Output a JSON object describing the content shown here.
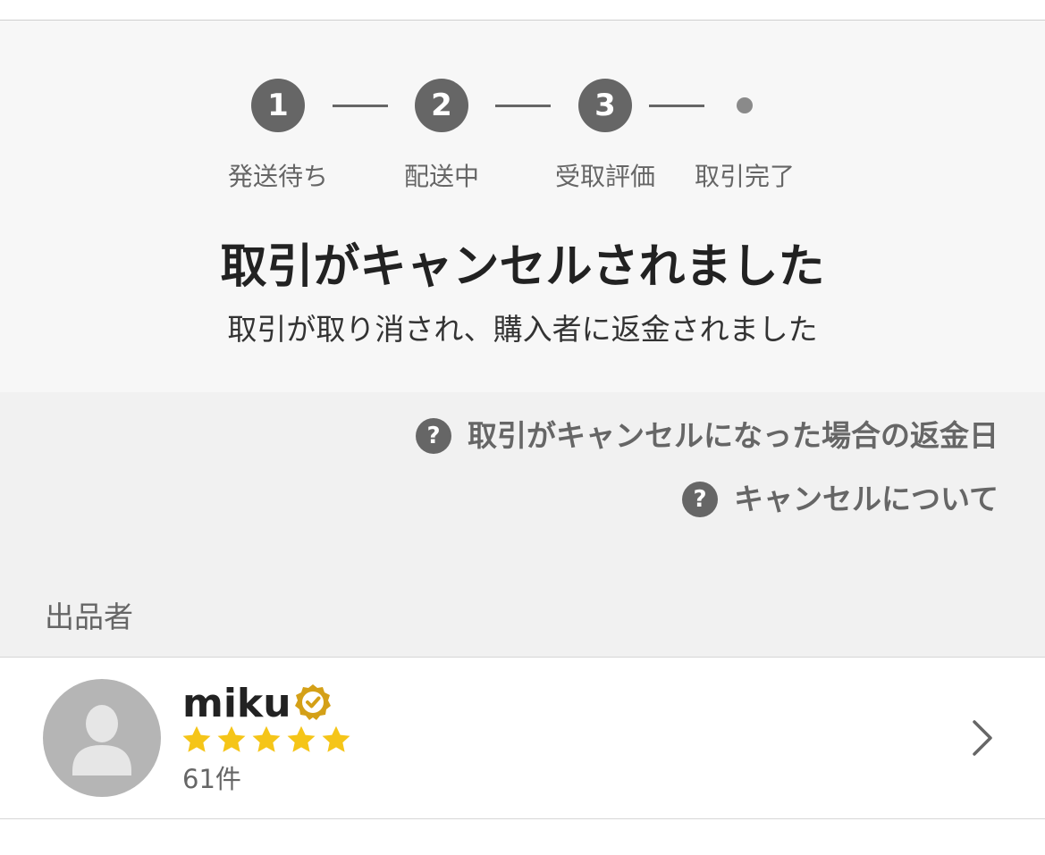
{
  "steps": [
    {
      "number": "1",
      "label": "発送待ち"
    },
    {
      "number": "2",
      "label": "配送中"
    },
    {
      "number": "3",
      "label": "受取評価"
    },
    {
      "number": "",
      "label": "取引完了"
    }
  ],
  "status": {
    "title": "取引がキャンセルされました",
    "subtitle": "取引が取り消され、購入者に返金されました"
  },
  "help_links": [
    {
      "icon": "question-circle-icon",
      "icon_glyph": "?",
      "label": "取引がキャンセルになった場合の返金日"
    },
    {
      "icon": "question-circle-icon",
      "icon_glyph": "?",
      "label": "キャンセルについて"
    }
  ],
  "seller_section": {
    "label": "出品者",
    "name": "miku",
    "verified_icon": "verified-badge-icon",
    "rating": 5,
    "rating_max": 5,
    "review_count": "61件"
  },
  "colors": {
    "step_active": "#666666",
    "star": "#f5c518",
    "badge": "#d4a017",
    "status_bg": "#f7f7f7",
    "links_bg": "#f1f1f1"
  }
}
